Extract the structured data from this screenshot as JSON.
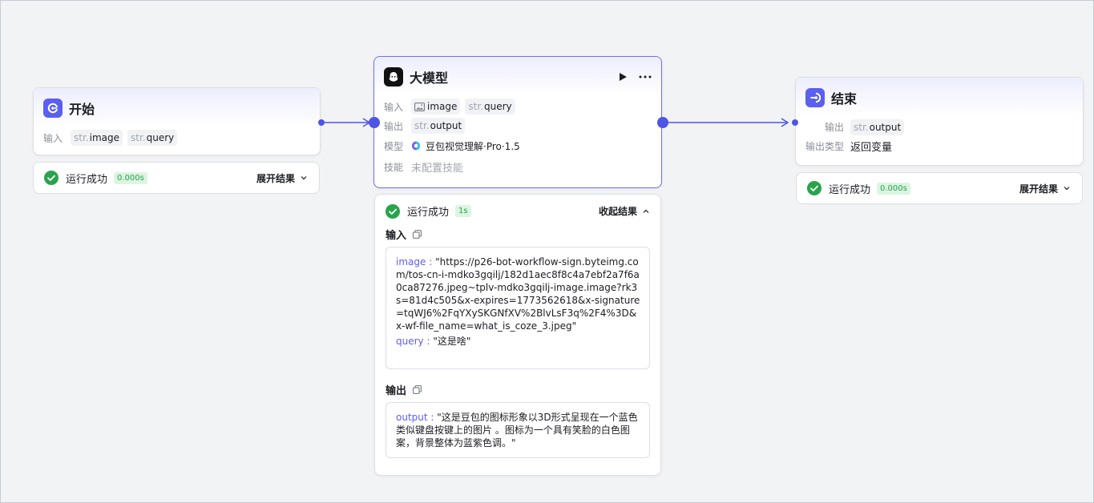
{
  "start_node": {
    "title": "开始",
    "input_label": "输入",
    "inputs": [
      {
        "type": "str.",
        "name": "image"
      },
      {
        "type": "str.",
        "name": "query"
      }
    ],
    "status": {
      "text": "运行成功",
      "time": "0.000s",
      "toggle": "展开结果"
    }
  },
  "llm_node": {
    "title": "大模型",
    "input_label": "输入",
    "inputs": [
      {
        "type": "image",
        "name": "image"
      },
      {
        "type": "str.",
        "name": "query"
      }
    ],
    "output_label": "输出",
    "outputs": [
      {
        "type": "str.",
        "name": "output"
      }
    ],
    "model_label": "模型",
    "model_name": "豆包视觉理解·Pro·1.5",
    "skill_label": "技能",
    "skill_value": "未配置技能",
    "status": {
      "text": "运行成功",
      "time": "1s",
      "toggle": "收起结果"
    },
    "result": {
      "input_title": "输入",
      "input_image_key": "image",
      "input_image_value": "\"https://p26-bot-workflow-sign.byteimg.com/tos-cn-i-mdko3gqilj/182d1aec8f8c4a7ebf2a7f6a0ca87276.jpeg~tplv-mdko3gqilj-image.image?rk3s=81d4c505&x-expires=1773562618&x-signature=tqWJ6%2FqYXySKGNfXV%2BlvLsF3q%2F4%3D&x-wf-file_name=what_is_coze_3.jpeg\"",
      "input_query_key": "query",
      "input_query_value": "\"这是啥\"",
      "output_title": "输出",
      "output_key": "output",
      "output_value": "\"这是豆包的图标形象以3D形式呈现在一个蓝色类似键盘按键上的图片 。图标为一个具有笑脸的白色图案，背景整体为蓝紫色调。\""
    }
  },
  "end_node": {
    "title": "结束",
    "output_label": "输出",
    "outputs": [
      {
        "type": "str.",
        "name": "output"
      }
    ],
    "output_type_label": "输出类型",
    "output_type_value": "返回变量",
    "status": {
      "text": "运行成功",
      "time": "0.000s",
      "toggle": "展开结果"
    }
  },
  "colors": {
    "accent": "#5a5ff0",
    "edge": "#4e55e6",
    "success": "#29a34c",
    "success_bg": "#dbf5e1"
  }
}
